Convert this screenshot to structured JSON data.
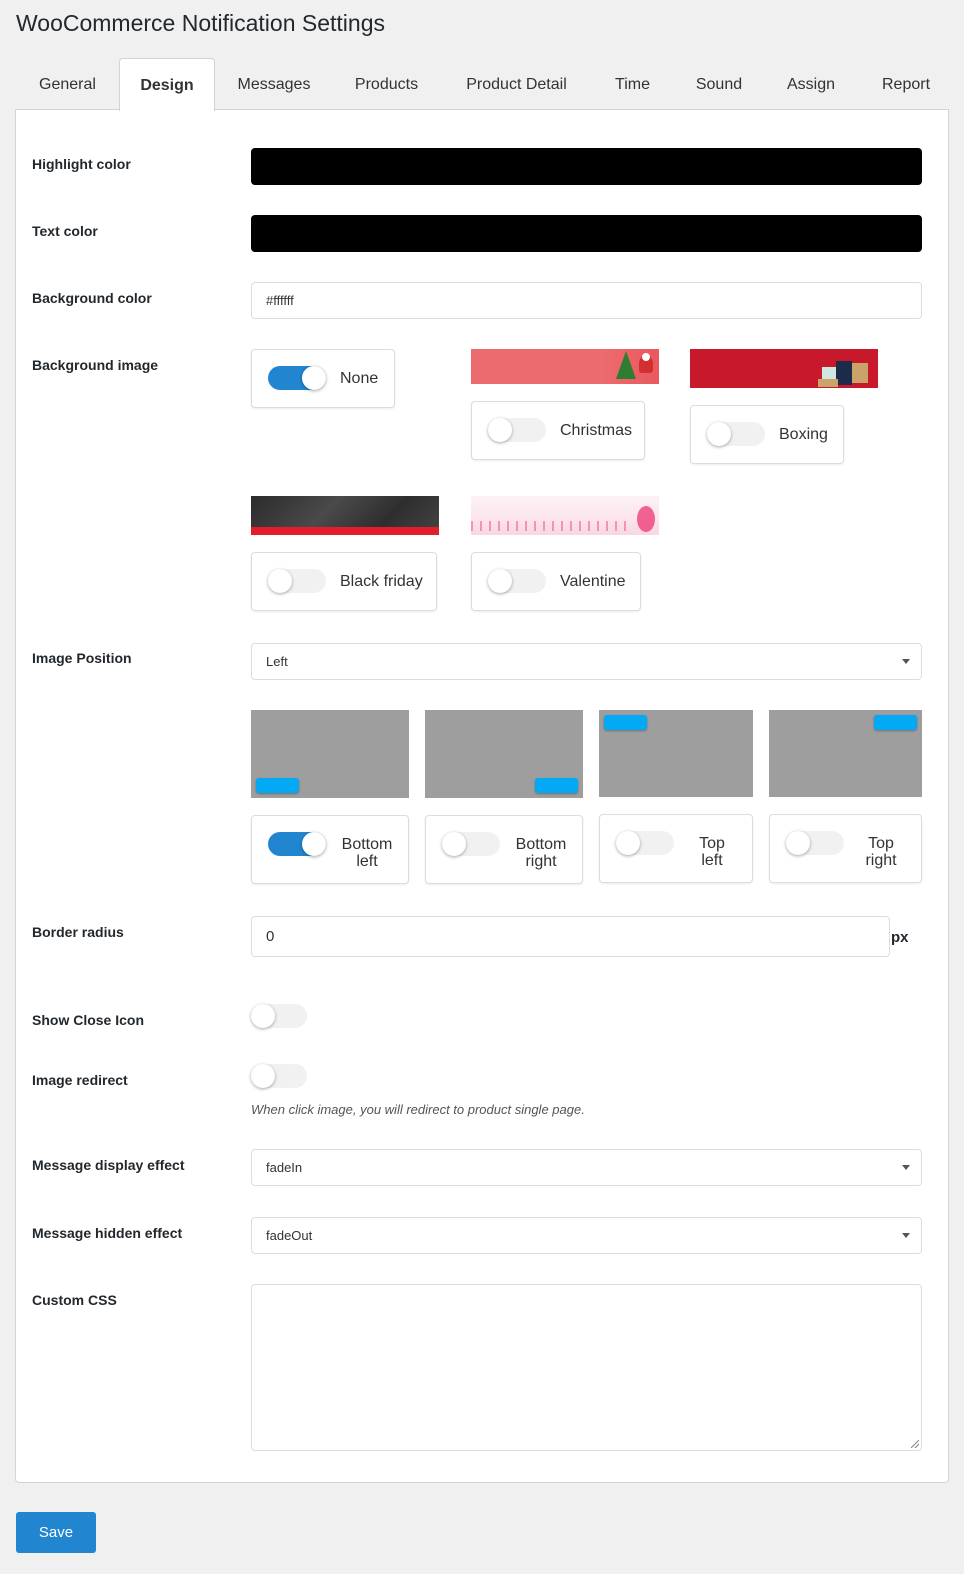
{
  "page": {
    "title": "WooCommerce Notification Settings"
  },
  "tabs": [
    {
      "label": "General",
      "active": false
    },
    {
      "label": "Design",
      "active": true
    },
    {
      "label": "Messages",
      "active": false
    },
    {
      "label": "Products",
      "active": false
    },
    {
      "label": "Product Detail",
      "active": false
    },
    {
      "label": "Time",
      "active": false
    },
    {
      "label": "Sound",
      "active": false
    },
    {
      "label": "Assign",
      "active": false
    },
    {
      "label": "Report",
      "active": false
    }
  ],
  "fields": {
    "highlight_color": {
      "label": "Highlight color",
      "value": "#000000"
    },
    "text_color": {
      "label": "Text color",
      "value": "#000000"
    },
    "background_color": {
      "label": "Background color",
      "value": "#ffffff"
    },
    "background_image": {
      "label": "Background image",
      "options": [
        {
          "label": "None",
          "checked": true
        },
        {
          "label": "Christmas",
          "checked": false
        },
        {
          "label": "Boxing",
          "checked": false
        },
        {
          "label": "Black friday",
          "checked": false
        },
        {
          "label": "Valentine",
          "checked": false
        }
      ]
    },
    "image_position": {
      "label": "Image Position",
      "selected": "Left",
      "options": [
        {
          "label_line1": "Bottom",
          "label_line2": "left",
          "checked": true
        },
        {
          "label_line1": "Bottom",
          "label_line2": "right",
          "checked": false
        },
        {
          "label_line1": "Top",
          "label_line2": "left",
          "checked": false
        },
        {
          "label_line1": "Top",
          "label_line2": "right",
          "checked": false
        }
      ]
    },
    "border_radius": {
      "label": "Border radius",
      "value": "0",
      "unit": "px"
    },
    "show_close_icon": {
      "label": "Show Close Icon",
      "checked": false
    },
    "image_redirect": {
      "label": "Image redirect",
      "checked": false,
      "help": "When click image, you will redirect to product single page."
    },
    "message_display_effect": {
      "label": "Message display effect",
      "selected": "fadeIn"
    },
    "message_hidden_effect": {
      "label": "Message hidden effect",
      "selected": "fadeOut"
    },
    "custom_css": {
      "label": "Custom CSS",
      "value": ""
    }
  },
  "actions": {
    "save_label": "Save"
  },
  "colors": {
    "accent": "#2185d0",
    "preview_bg": "#9e9e9e",
    "preview_pill": "#03a9f4"
  }
}
